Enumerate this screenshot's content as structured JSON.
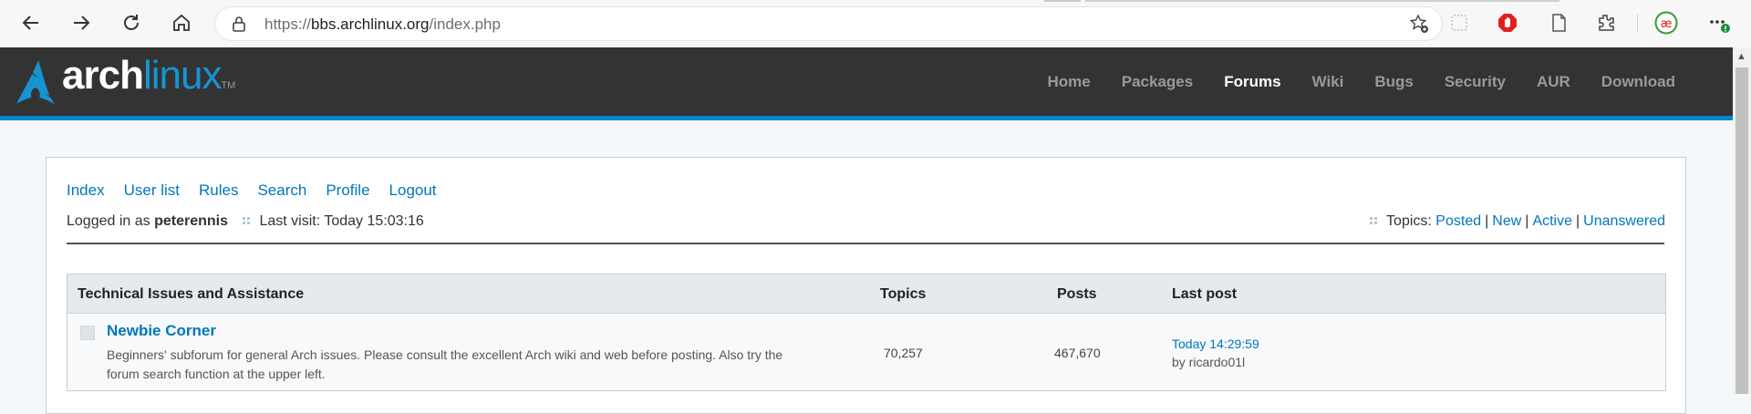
{
  "browser": {
    "url_protocol": "https://",
    "url_host": "bbs.archlinux.org",
    "url_path": "/index.php"
  },
  "site": {
    "logo_arch": "arch",
    "logo_linux": "linux",
    "logo_tm": "TM",
    "nav": [
      "Home",
      "Packages",
      "Forums",
      "Wiki",
      "Bugs",
      "Security",
      "AUR",
      "Download"
    ],
    "active_nav": "Forums",
    "accent_color": "#1793d1"
  },
  "subnav": [
    "Index",
    "User list",
    "Rules",
    "Search",
    "Profile",
    "Logout"
  ],
  "status": {
    "logged_in_prefix": "Logged in as",
    "username": "peterennis",
    "last_visit": "Last visit: Today 15:03:16",
    "topics_label": "Topics:",
    "topic_links": [
      "Posted",
      "New",
      "Active",
      "Unanswered"
    ]
  },
  "table": {
    "category": "Technical Issues and Assistance",
    "col_topics": "Topics",
    "col_posts": "Posts",
    "col_lastpost": "Last post",
    "rows": [
      {
        "title": "Newbie Corner",
        "description": "Beginners' subforum for general Arch issues. Please consult the excellent Arch wiki and web before posting. Also try the forum search function at the upper left.",
        "topics": "70,257",
        "posts": "467,670",
        "last_post_time": "Today 14:29:59",
        "last_post_by": "by ricardo01l"
      }
    ]
  }
}
